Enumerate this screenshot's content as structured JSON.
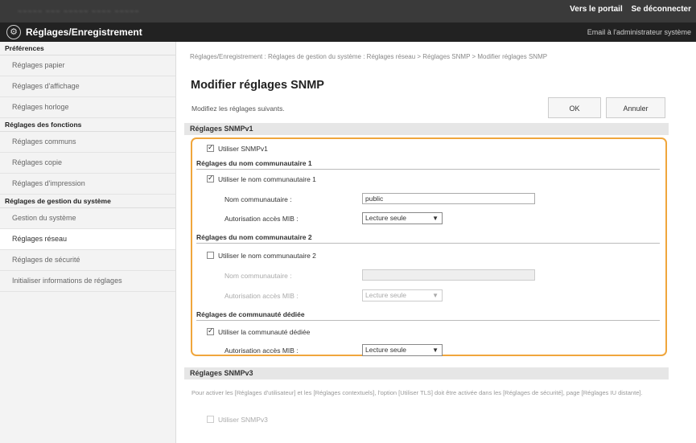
{
  "topbar": {
    "blurred_text": "~~~~~  ~~~ ~~~~~ ~~~~ ~~~~~",
    "portal": "Vers le portail",
    "logout": "Se déconnecter"
  },
  "app": {
    "title": "Réglages/Enregistrement",
    "email": "Email à l'administrateur système",
    "logo_icon": "gear-icon"
  },
  "sidebar": {
    "sec1": "Préférences",
    "items1": [
      "Réglages papier",
      "Réglages d'affichage",
      "Réglages horloge"
    ],
    "sec2": "Réglages des fonctions",
    "items2": [
      "Réglages communs",
      "Réglages copie",
      "Réglages d'impression"
    ],
    "sec3": "Réglages de gestion du système",
    "items3": [
      "Gestion du système",
      "Réglages réseau",
      "Réglages de sécurité",
      "Initialiser informations de réglages"
    ],
    "active": "Réglages réseau"
  },
  "main": {
    "breadcrumb": "Réglages/Enregistrement : Réglages de gestion du système : Réglages réseau > Réglages SNMP > Modifier réglages SNMP",
    "title": "Modifier réglages SNMP",
    "intro": "Modifiez les réglages suivants.",
    "ok": "OK",
    "cancel": "Annuler"
  },
  "snmpv1": {
    "header": "Réglages SNMPv1",
    "use": {
      "label": "Utiliser SNMPv1",
      "checked": true
    },
    "c1": {
      "heading": "Réglages du nom communautaire 1",
      "use_label": "Utiliser le nom communautaire 1",
      "checked": true,
      "name_label": "Nom communautaire :",
      "name_value": "public",
      "mib_label": "Autorisation accès MIB :",
      "mib_value": "Lecture seule"
    },
    "c2": {
      "heading": "Réglages du nom communautaire 2",
      "use_label": "Utiliser le nom communautaire 2",
      "checked": false,
      "name_label": "Nom communautaire :",
      "name_value": "",
      "mib_label": "Autorisation accès MIB :",
      "mib_value": "Lecture seule"
    },
    "dedicated": {
      "heading": "Réglages de communauté dédiée",
      "use_label": "Utiliser la communauté dédiée",
      "checked": true,
      "mib_label": "Autorisation accès MIB :",
      "mib_value": "Lecture seule"
    }
  },
  "snmpv3": {
    "header": "Réglages SNMPv3",
    "note": "Pour activer les [Réglages d'utilisateur] et les [Réglages contextuels], l'option [Utiliser TLS] doit être activée dans les [Réglages de sécurité], page [Réglages IU distante].",
    "use_label": "Utiliser SNMPv3"
  },
  "colors": {
    "accent": "#f0a63c",
    "topbar": "#3a3a3a",
    "titlebar": "#222222"
  }
}
